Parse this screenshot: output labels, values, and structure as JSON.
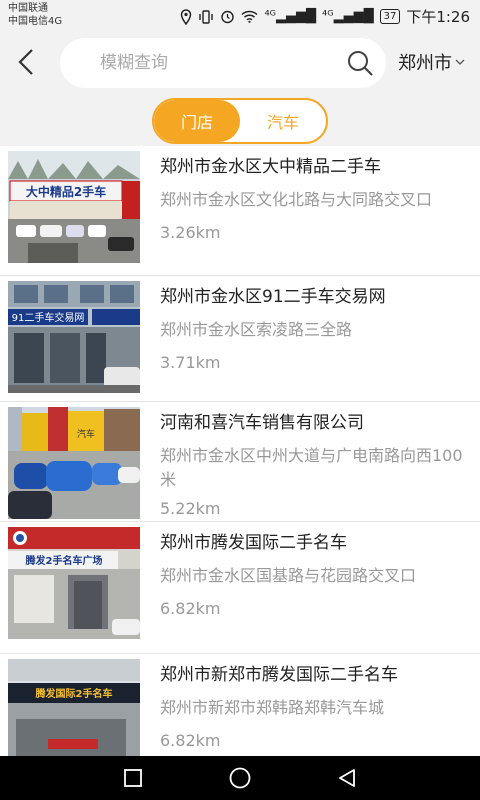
{
  "status": {
    "carrier1": "中国联通",
    "carrier2": "中国电信4G",
    "network1": "⁴ᴳ",
    "network2": "⁴ᴳ",
    "battery": "37",
    "time": "下午1:26"
  },
  "header": {
    "search_placeholder": "模糊查询",
    "city": "郑州市"
  },
  "tabs": [
    {
      "label": "门店",
      "active": true
    },
    {
      "label": "汽车",
      "active": false
    }
  ],
  "dealers": [
    {
      "name": "郑州市金水区大中精品二手车",
      "address": "郑州市金水区文化北路与大同路交叉口",
      "distance": "3.26km",
      "sign": "大中精品2手车"
    },
    {
      "name": "郑州市金水区91二手车交易网",
      "address": "郑州市金水区索凌路三全路",
      "distance": "3.71km",
      "sign": "91二手车交易网"
    },
    {
      "name": "河南和喜汽车销售有限公司",
      "address": "郑州市金水区中州大道与广电南路向西100米",
      "distance": "5.22km",
      "sign": "汽车"
    },
    {
      "name": "郑州市腾发国际二手名车",
      "address": "郑州市金水区国基路与花园路交叉口",
      "distance": "6.82km",
      "sign": "腾发2手名车广场"
    },
    {
      "name": "郑州市新郑市腾发国际二手名车",
      "address": "郑州市新郑市郑韩路郑韩汽车城",
      "distance": "6.82km",
      "sign": "腾发国际2手名车"
    }
  ],
  "colors": {
    "accent": "#f5a623"
  }
}
